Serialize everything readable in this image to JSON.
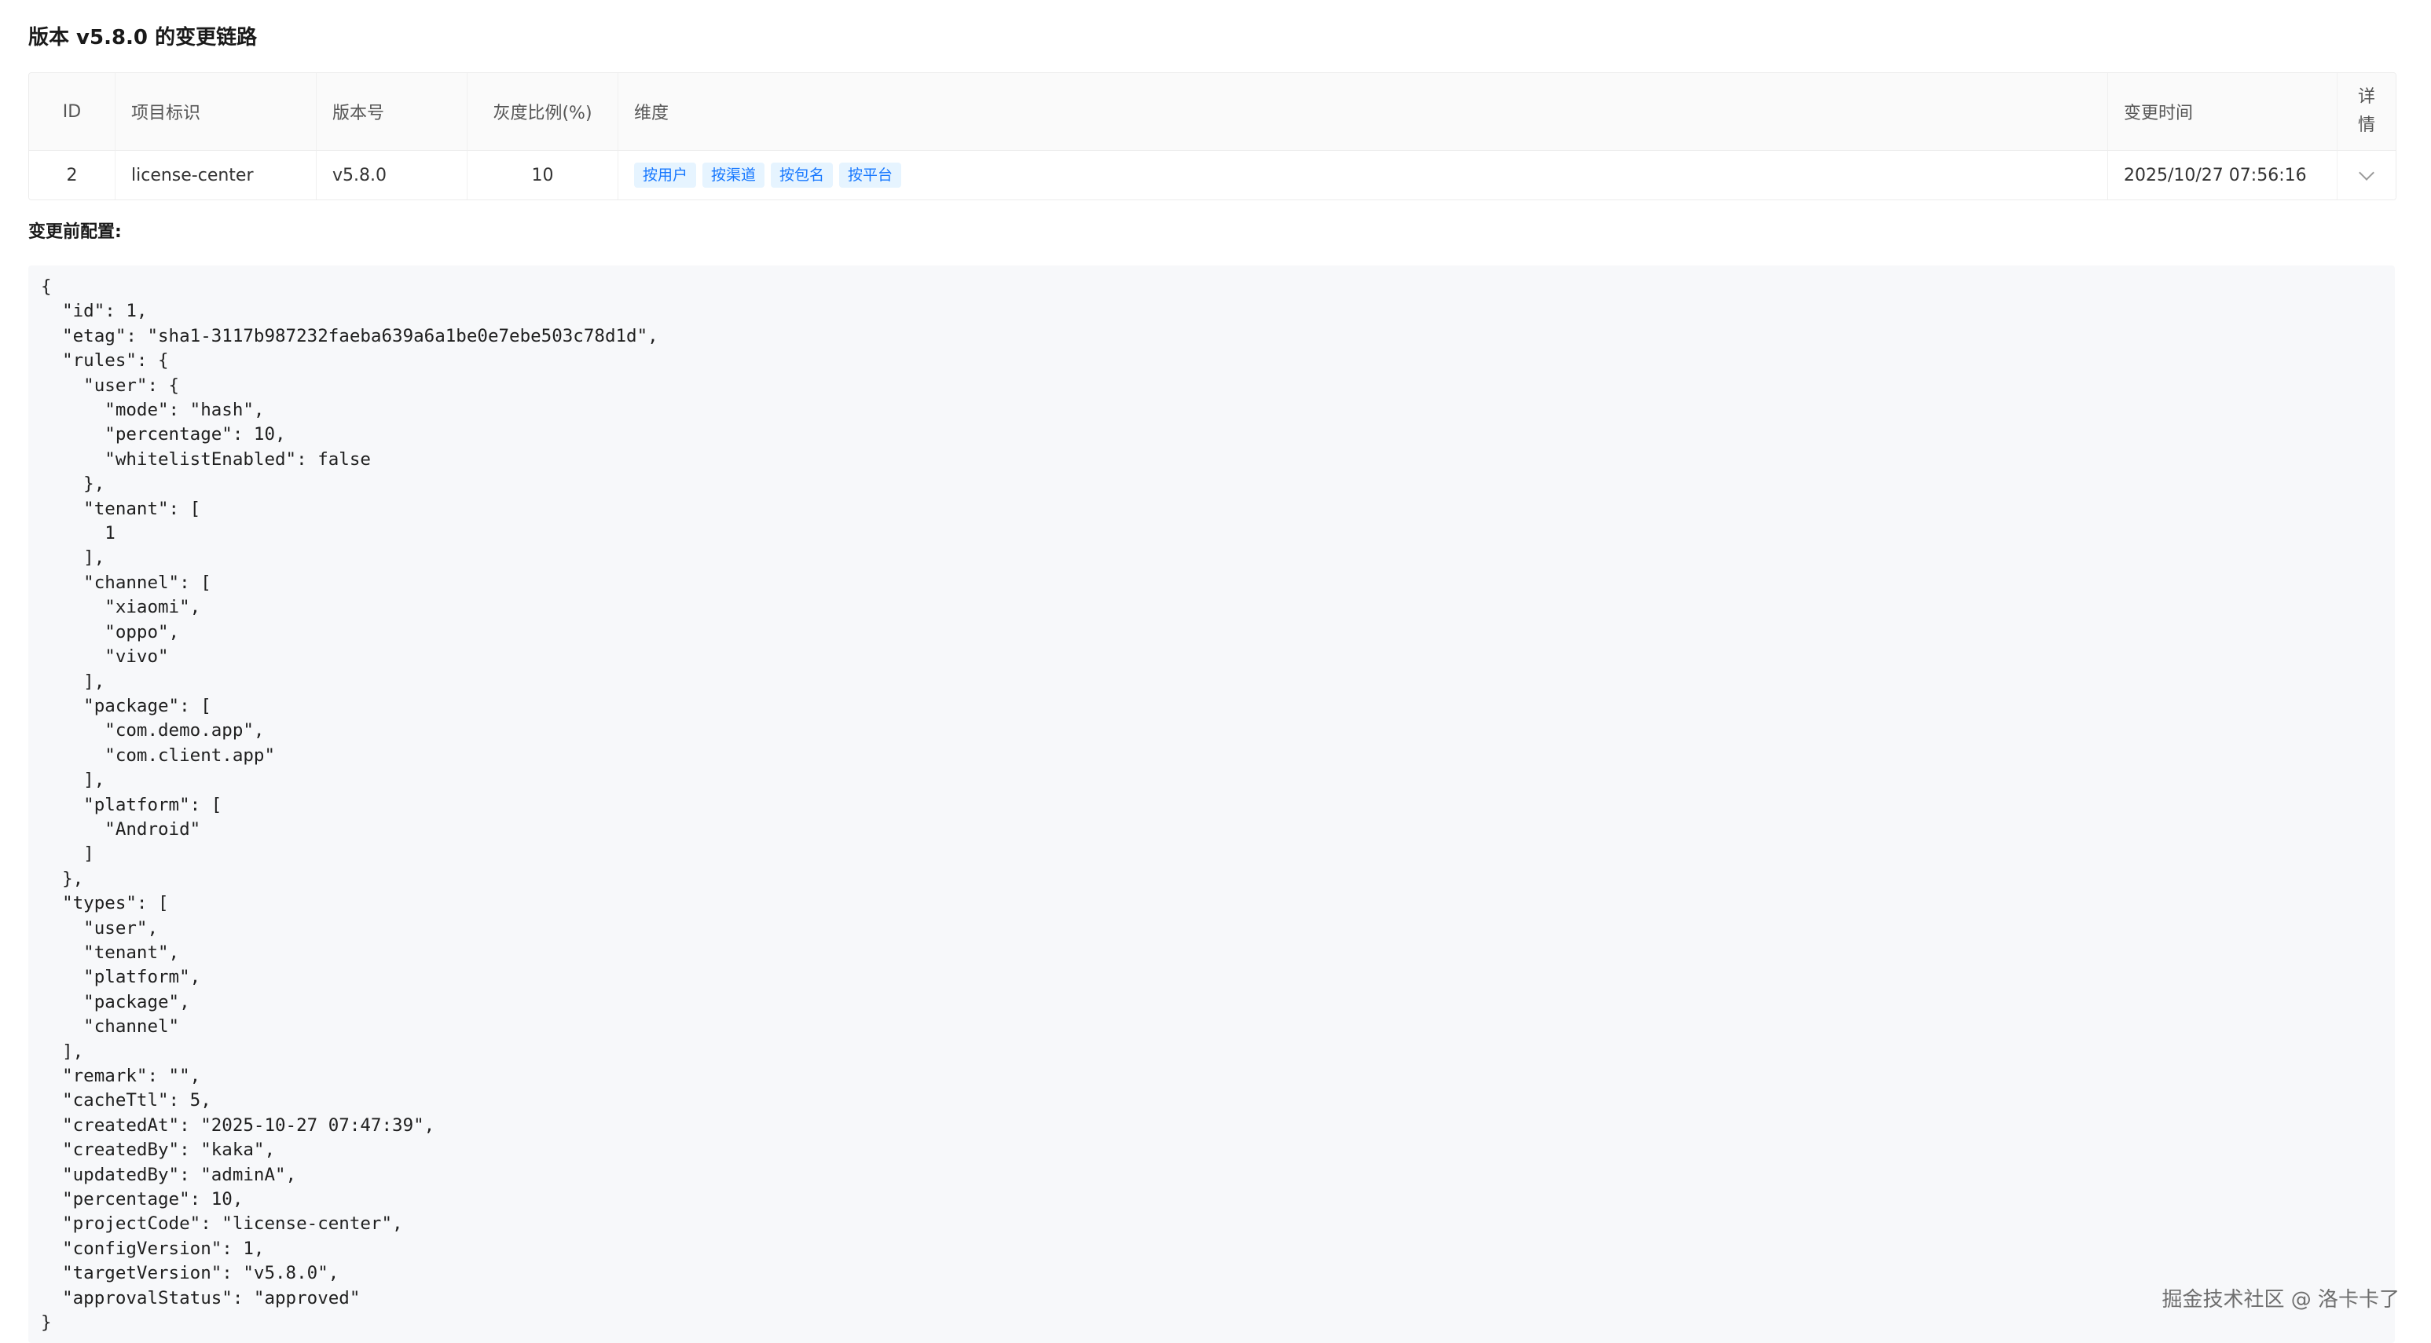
{
  "section": {
    "title": "版本 v5.8.0 的变更链路"
  },
  "table": {
    "headers": {
      "id": "ID",
      "project": "项目标识",
      "version": "版本号",
      "gray": "灰度比例(%)",
      "dimension": "维度",
      "time": "变更时间",
      "detail_line1": "详",
      "detail_line2": "情"
    },
    "rows": [
      {
        "id": "2",
        "project": "license-center",
        "version": "v5.8.0",
        "gray": "10",
        "tags": [
          "按用户",
          "按渠道",
          "按包名",
          "按平台"
        ],
        "time": "2025/10/27 07:56:16"
      }
    ]
  },
  "before_config": {
    "label": "变更前配置:",
    "json_text": "{\n  \"id\": 1,\n  \"etag\": \"sha1-3117b987232faeba639a6a1be0e7ebe503c78d1d\",\n  \"rules\": {\n    \"user\": {\n      \"mode\": \"hash\",\n      \"percentage\": 10,\n      \"whitelistEnabled\": false\n    },\n    \"tenant\": [\n      1\n    ],\n    \"channel\": [\n      \"xiaomi\",\n      \"oppo\",\n      \"vivo\"\n    ],\n    \"package\": [\n      \"com.demo.app\",\n      \"com.client.app\"\n    ],\n    \"platform\": [\n      \"Android\"\n    ]\n  },\n  \"types\": [\n    \"user\",\n    \"tenant\",\n    \"platform\",\n    \"package\",\n    \"channel\"\n  ],\n  \"remark\": \"\",\n  \"cacheTtl\": 5,\n  \"createdAt\": \"2025-10-27 07:47:39\",\n  \"createdBy\": \"kaka\",\n  \"updatedBy\": \"adminA\",\n  \"percentage\": 10,\n  \"projectCode\": \"license-center\",\n  \"configVersion\": 1,\n  \"targetVersion\": \"v5.8.0\",\n  \"approvalStatus\": \"approved\"\n}"
  },
  "watermark": "掘金技术社区 @ 洛卡卡了",
  "colors": {
    "tag_text": "#1677ff",
    "tag_bg": "#e6f4ff",
    "code_bg": "#f7f8fa",
    "header_bg": "#fafafa"
  },
  "icons": {
    "expand": "chevron-down-icon"
  }
}
